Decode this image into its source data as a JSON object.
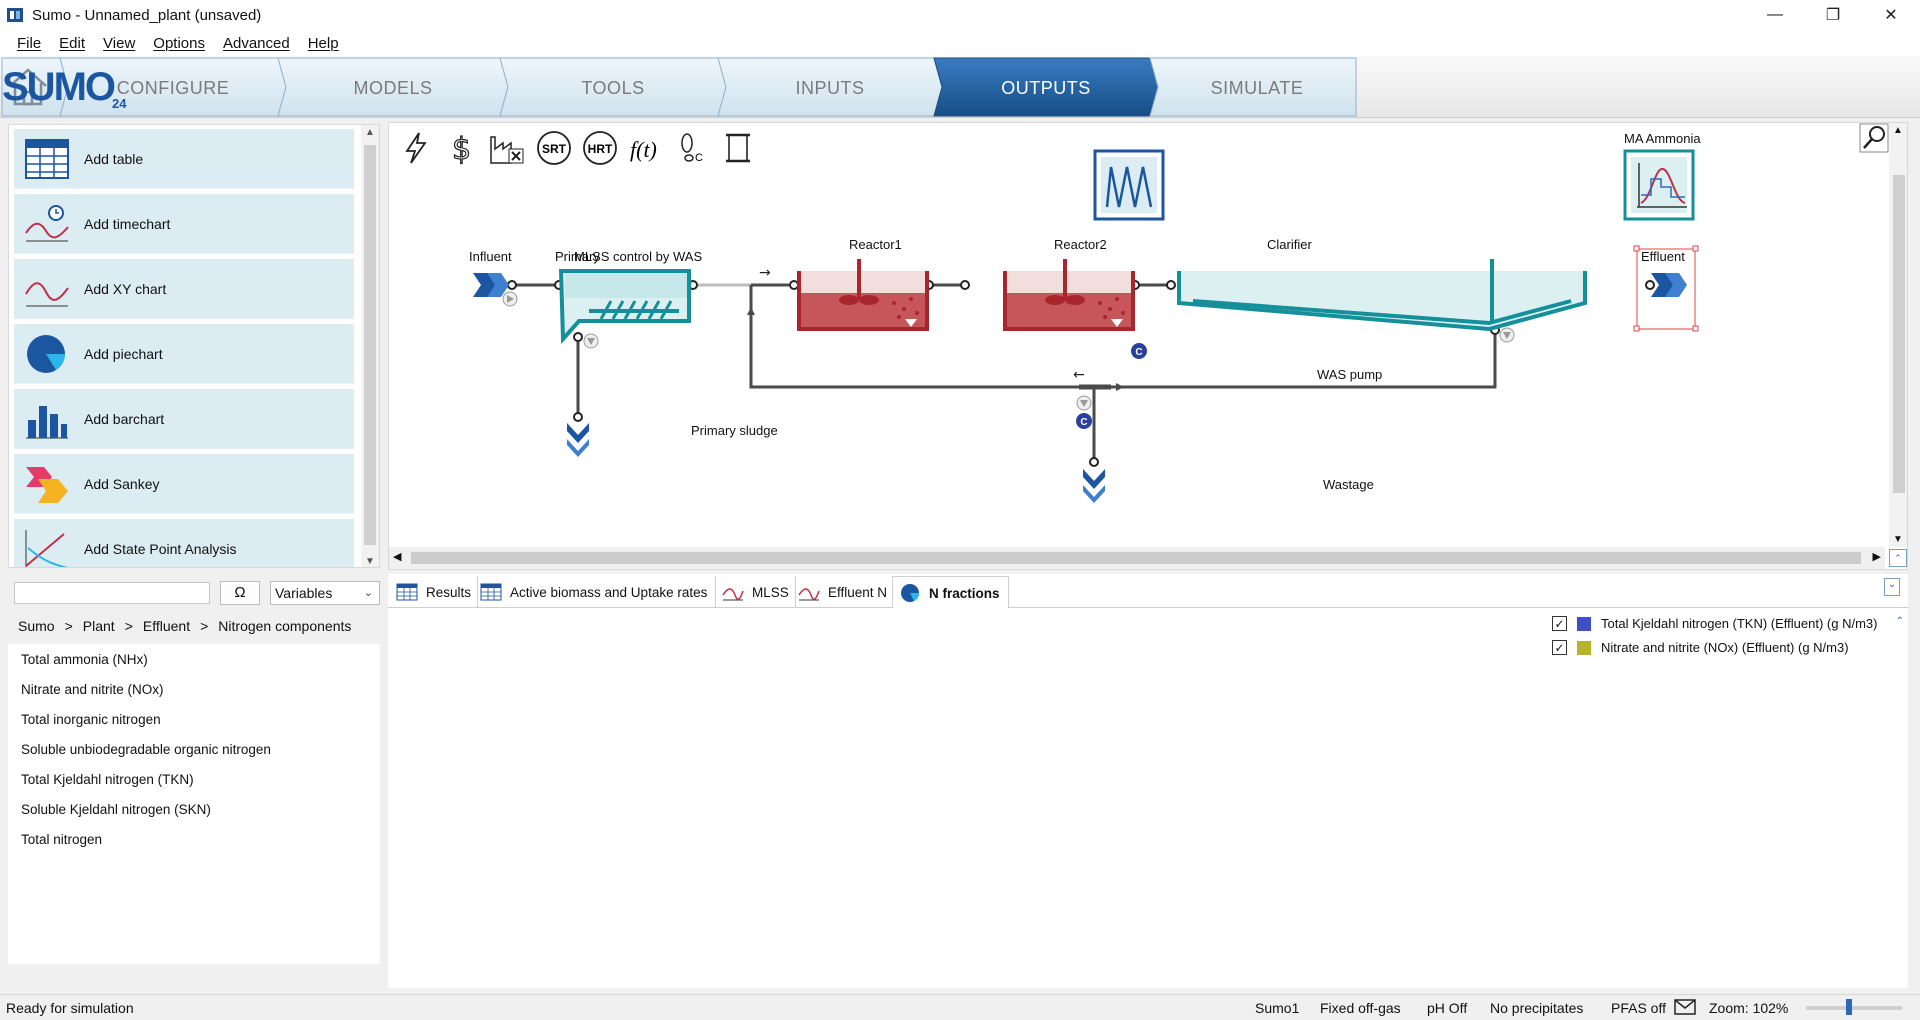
{
  "window": {
    "title": "Sumo - Unnamed_plant (unsaved)",
    "controls": [
      "—",
      "❐",
      "✕"
    ]
  },
  "menu": [
    "File",
    "Edit",
    "View",
    "Options",
    "Advanced",
    "Help"
  ],
  "nav": {
    "tabs": [
      "CONFIGURE",
      "MODELS",
      "TOOLS",
      "INPUTS",
      "OUTPUTS",
      "SIMULATE"
    ],
    "active": "OUTPUTS",
    "logo_text": "SUMO",
    "logo_version": "24"
  },
  "add_panel": {
    "items": [
      {
        "label": "Add table",
        "icon": "table-icon"
      },
      {
        "label": "Add timechart",
        "icon": "timechart-icon"
      },
      {
        "label": "Add XY chart",
        "icon": "xy-chart-icon"
      },
      {
        "label": "Add piechart",
        "icon": "piechart-icon"
      },
      {
        "label": "Add barchart",
        "icon": "barchart-icon"
      },
      {
        "label": "Add Sankey",
        "icon": "sankey-icon"
      },
      {
        "label": "Add State Point Analysis",
        "icon": "state-point-icon"
      }
    ]
  },
  "canvas": {
    "toolbar": [
      "lightning-icon",
      "dollar-icon",
      "factory-icon",
      "SRT",
      "HRT",
      "f(t)",
      "footprint-icon",
      "scroll-icon"
    ],
    "toolbar_text": {
      "srt": "SRT",
      "hrt": "HRT",
      "fx": "f(t)"
    },
    "widgets": {
      "mlss_control": "MLSS control by WAS",
      "ma_ammonia": "MA Ammonia"
    },
    "units": {
      "influent": "Influent",
      "primary": "Primary",
      "reactor1": "Reactor1",
      "reactor2": "Reactor2",
      "clarifier": "Clarifier",
      "effluent": "Effluent",
      "primary_sludge": "Primary sludge",
      "was_pump": "WAS pump",
      "wastage": "Wastage"
    },
    "controller_badge": "C"
  },
  "variables": {
    "search_value": "",
    "omega": "Ω",
    "dropdown": "Variables",
    "breadcrumb": [
      "Sumo",
      ">",
      "Plant",
      ">",
      "Effluent",
      ">",
      "Nitrogen components"
    ],
    "items": [
      "Total ammonia (NHx)",
      "Nitrate and nitrite (NOx)",
      "Total inorganic nitrogen",
      "Soluble unbiodegradable organic nitrogen",
      "Total Kjeldahl nitrogen (TKN)",
      "Soluble Kjeldahl nitrogen (SKN)",
      "Total nitrogen"
    ]
  },
  "output_tabs": {
    "tabs": [
      {
        "label": "Results",
        "icon": "table-icon"
      },
      {
        "label": "Active biomass and Uptake rates",
        "icon": "table-icon"
      },
      {
        "label": "MLSS",
        "icon": "timechart-icon"
      },
      {
        "label": "Effluent N",
        "icon": "timechart-icon"
      },
      {
        "label": "N fractions",
        "icon": "piechart-icon"
      }
    ],
    "active": "N fractions"
  },
  "legend": {
    "items": [
      {
        "label": "Total Kjeldahl nitrogen (TKN) (Effluent) (g N/m3)",
        "color": "#3f4fc8",
        "checked": true
      },
      {
        "label": "Nitrate and nitrite (NOx) (Effluent) (g N/m3)",
        "color": "#b5b32a",
        "checked": true
      }
    ]
  },
  "status": {
    "message": "Ready for simulation",
    "model": "Sumo1",
    "offgas": "Fixed off-gas",
    "ph": "pH Off",
    "precip": "No precipitates",
    "pfas": "PFAS off",
    "zoom": "Zoom: 102%"
  },
  "colors": {
    "nav_active": "#1f5f9e",
    "panel_bg": "#dcecf3",
    "teal": "#158f9a",
    "reactor_red": "#a8262c",
    "pipe": "#4a4a4a"
  }
}
